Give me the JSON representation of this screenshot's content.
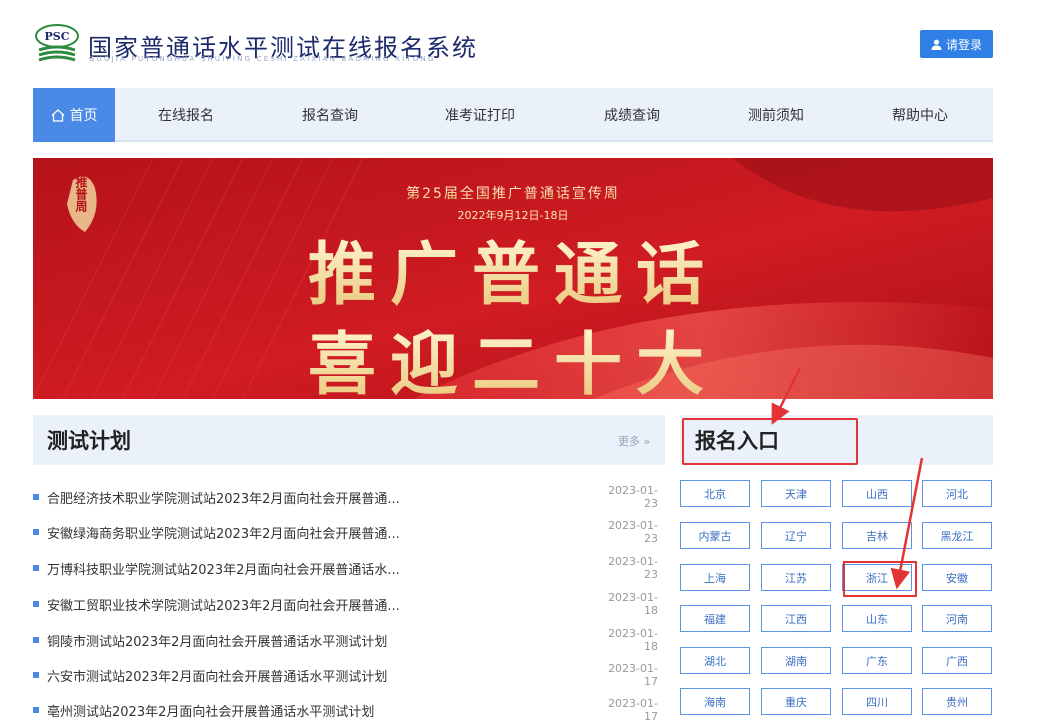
{
  "header": {
    "logo_text": "PSC",
    "title": "国家普通话水平测试在线报名系统",
    "subtitle": "GUOJIA PUTONGHUA SHUIPING CESHI ZAIXIAN BAOMING XITONG",
    "login_label": "请登录"
  },
  "nav": {
    "items": [
      "首页",
      "在线报名",
      "报名查询",
      "准考证打印",
      "成绩查询",
      "测前须知",
      "帮助中心"
    ]
  },
  "banner": {
    "seal_text": "推普周",
    "headline": "第25届全国推广普通话宣传周",
    "date": "2022年9月12日-18日",
    "line1": "推广普通话",
    "line2": "喜迎二十大"
  },
  "plan": {
    "title": "测试计划",
    "more_label": "更多 »",
    "items": [
      {
        "text": "合肥经济技术职业学院测试站2023年2月面向社会开展普通...",
        "date": "2023-01-23"
      },
      {
        "text": "安徽绿海商务职业学院测试站2023年2月面向社会开展普通...",
        "date": "2023-01-23"
      },
      {
        "text": "万博科技职业学院测试站2023年2月面向社会开展普通话水...",
        "date": "2023-01-23"
      },
      {
        "text": "安徽工贸职业技术学院测试站2023年2月面向社会开展普通...",
        "date": "2023-01-18"
      },
      {
        "text": "铜陵市测试站2023年2月面向社会开展普通话水平测试计划",
        "date": "2023-01-18"
      },
      {
        "text": "六安市测试站2023年2月面向社会开展普通话水平测试计划",
        "date": "2023-01-17"
      },
      {
        "text": "亳州测试站2023年2月面向社会开展普通话水平测试计划",
        "date": "2023-01-17"
      }
    ]
  },
  "register": {
    "title": "报名入口",
    "provinces": [
      "北京",
      "天津",
      "山西",
      "河北",
      "内蒙古",
      "辽宁",
      "吉林",
      "黑龙江",
      "上海",
      "江苏",
      "浙江",
      "安徽",
      "福建",
      "江西",
      "山东",
      "河南",
      "湖北",
      "湖南",
      "广东",
      "广西",
      "海南",
      "重庆",
      "四川",
      "贵州"
    ]
  },
  "colors": {
    "accent": "#4a8ae6",
    "nav_bg": "#eaf1fb",
    "highlight_red": "#e23434",
    "banner_red": "#c8161d",
    "banner_gold": "#f6e2a3"
  }
}
